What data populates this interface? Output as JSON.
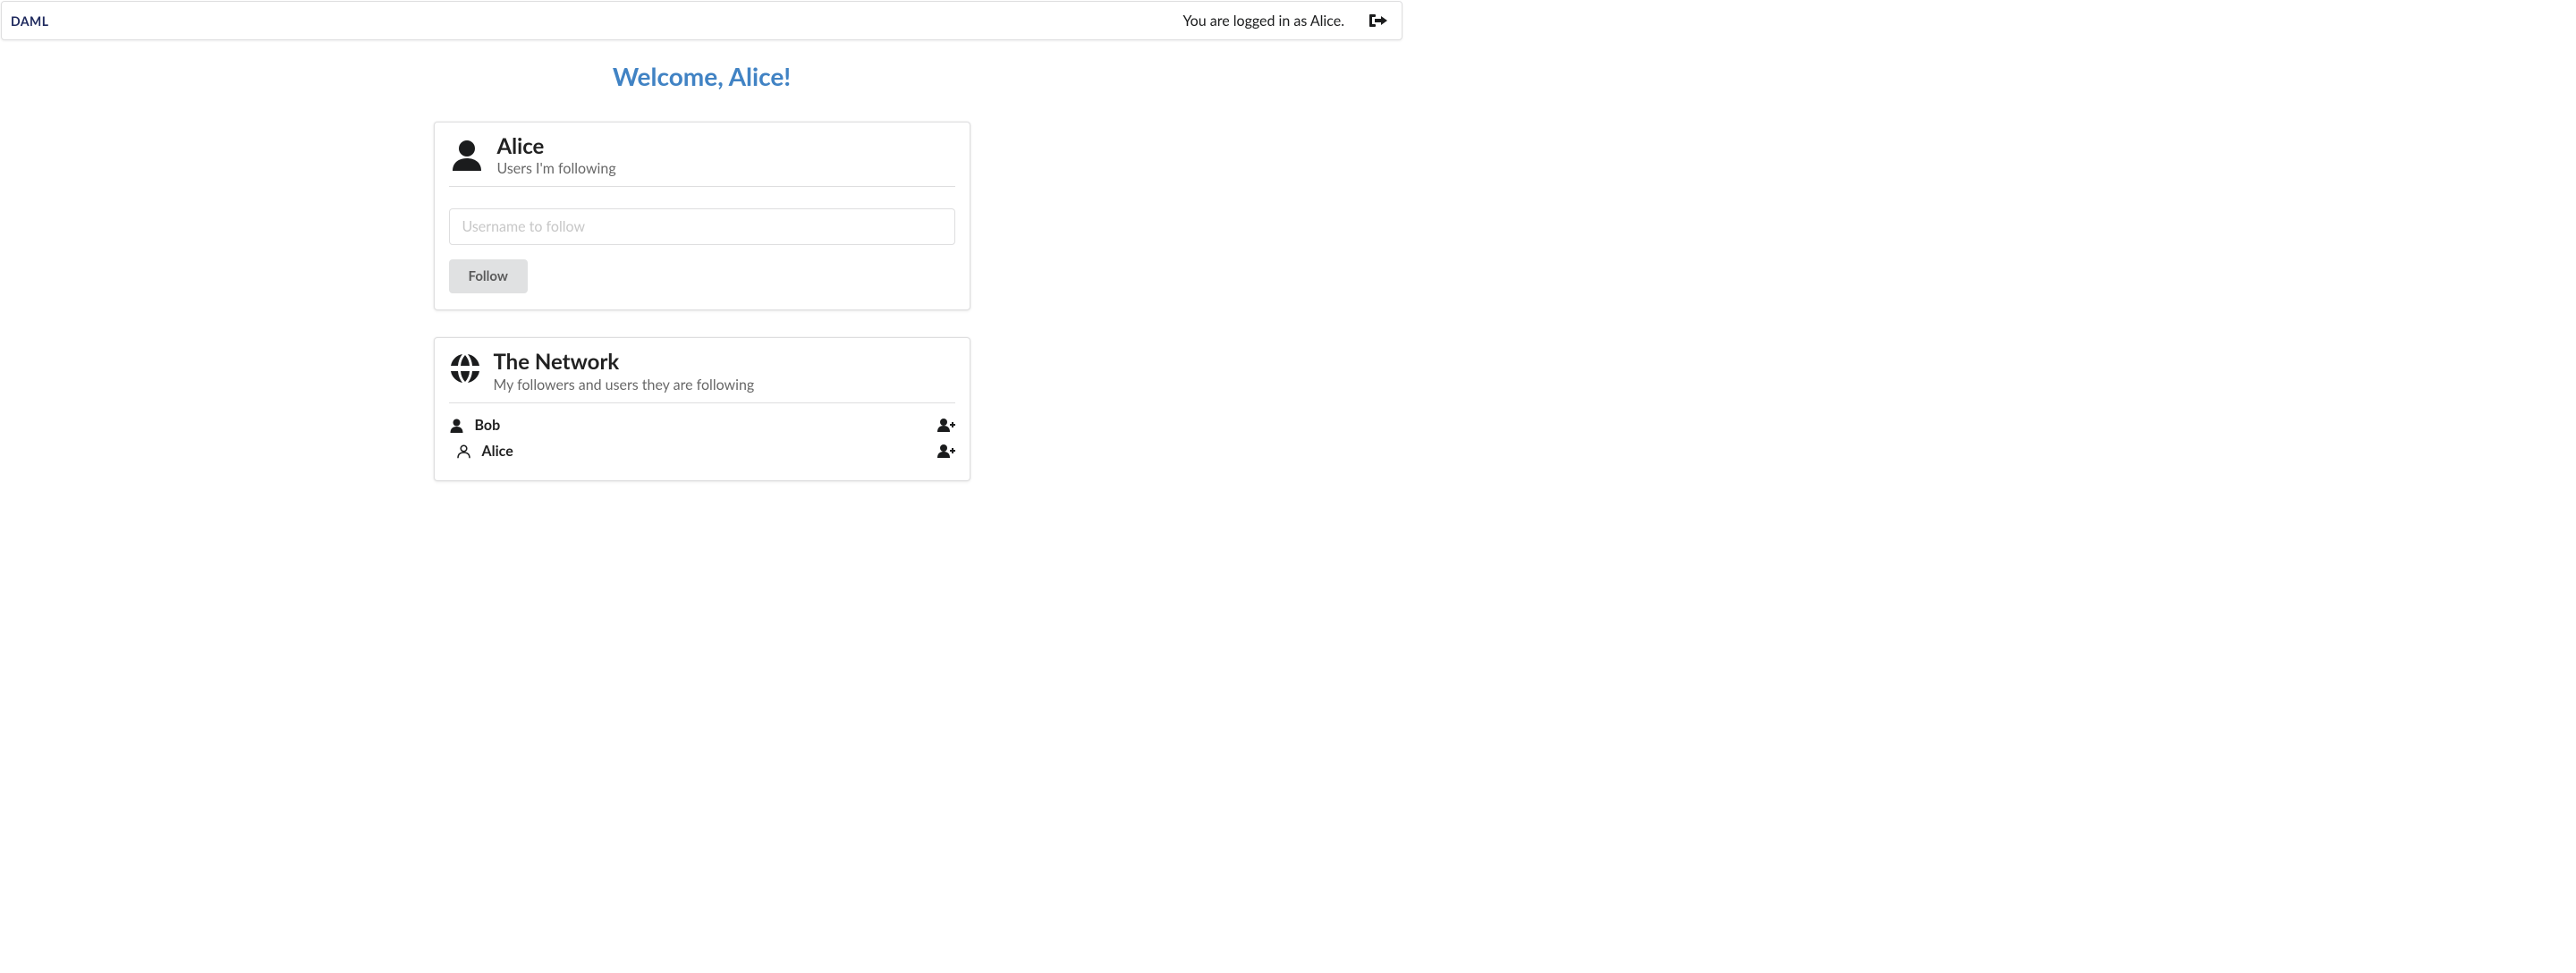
{
  "header": {
    "logo_text": "DAML",
    "login_status": "You are logged in as Alice."
  },
  "welcome_text": "Welcome, Alice!",
  "profile_card": {
    "title": "Alice",
    "subtitle": "Users I'm following",
    "input_placeholder": "Username to follow",
    "follow_button": "Follow"
  },
  "network_card": {
    "title": "The Network",
    "subtitle": "My followers and users they are following",
    "rows": [
      {
        "name": "Bob",
        "children": [
          {
            "name": "Alice"
          }
        ]
      }
    ]
  }
}
